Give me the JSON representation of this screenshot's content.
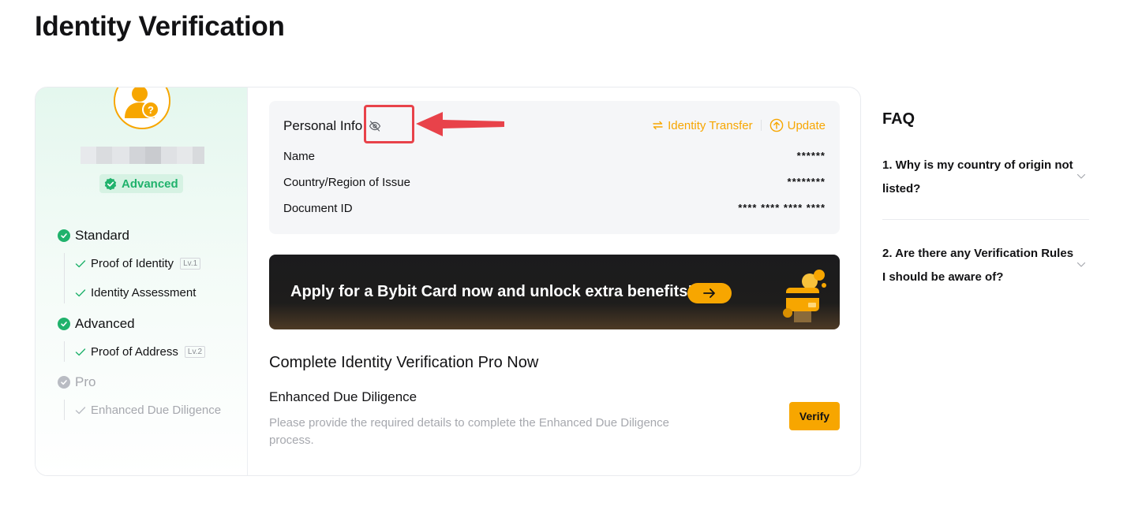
{
  "page": {
    "title": "Identity Verification"
  },
  "colors": {
    "accent": "#f7a600",
    "success": "#20b26c",
    "annotation": "#e8424a",
    "muted": "#a6a8ae"
  },
  "profile": {
    "level_badge": "Advanced",
    "avatar_icon": "user-question-icon"
  },
  "steps": [
    {
      "label": "Standard",
      "status": "completed",
      "items": [
        {
          "label": "Proof of Identity",
          "tag": "Lv.1"
        },
        {
          "label": "Identity Assessment",
          "tag": ""
        }
      ]
    },
    {
      "label": "Advanced",
      "status": "completed",
      "items": [
        {
          "label": "Proof of Address",
          "tag": "Lv.2"
        }
      ]
    },
    {
      "label": "Pro",
      "status": "pending",
      "items": [
        {
          "label": "Enhanced Due Diligence",
          "tag": ""
        }
      ]
    }
  ],
  "personal_info": {
    "title": "Personal Info",
    "toggle_icon": "eye-off-icon",
    "transfer_label": "Identity Transfer",
    "update_label": "Update",
    "rows": [
      {
        "label": "Name",
        "value": "******"
      },
      {
        "label": "Country/Region of Issue",
        "value": "********"
      },
      {
        "label": "Document ID",
        "value": "**** **** **** ****"
      }
    ]
  },
  "banner": {
    "text": "Apply for a Bybit Card now and unlock extra benefits!"
  },
  "pro": {
    "heading": "Complete Identity Verification Pro Now",
    "edd_title": "Enhanced Due Diligence",
    "edd_desc": "Please provide the required details to complete the Enhanced Due Diligence process.",
    "verify_label": "Verify"
  },
  "faq": {
    "title": "FAQ",
    "items": [
      {
        "question": "1. Why is my country of origin not listed?"
      },
      {
        "question": "2. Are there any Verification Rules I should be aware of?"
      }
    ]
  }
}
